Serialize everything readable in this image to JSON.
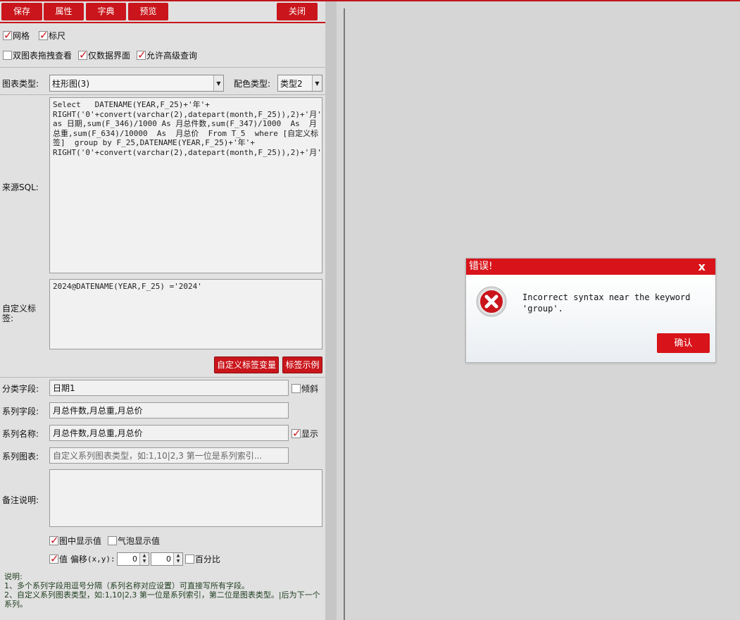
{
  "toolbar": {
    "save": "保存",
    "properties": "属性",
    "dictionary": "字典",
    "preview": "预览",
    "close": "关闭"
  },
  "options": {
    "grid": {
      "label": "网格",
      "checked": true
    },
    "ruler": {
      "label": "标尺",
      "checked": true
    },
    "dual_drag": {
      "label": "双图表拖拽查看",
      "checked": false
    },
    "data_only": {
      "label": "仅数据界面",
      "checked": true
    },
    "advanced_query": {
      "label": "允许高级查询",
      "checked": true
    }
  },
  "chart_type": {
    "label": "图表类型:",
    "value": "柱形图(3)"
  },
  "color_type": {
    "label": "配色类型:",
    "value": "类型2"
  },
  "source_sql": {
    "label": "来源SQL:",
    "value": "Select   DATENAME(YEAR,F_25)+'年'+   RIGHT('0'+convert(varchar(2),datepart(month,F_25)),2)+'月' as 日期,sum(F_346)/1000 As 月总件数,sum(F_347)/1000  As  月总重,sum(F_634)/10000  As  月总价  From T_5  where [自定义标签]  group by F_25,DATENAME(YEAR,F_25)+'年'+    RIGHT('0'+convert(varchar(2),datepart(month,F_25)),2)+'月'"
  },
  "custom_tag": {
    "label": "自定义标签:",
    "value": "2024@DATENAME(YEAR,F_25) ='2024'"
  },
  "tag_buttons": {
    "variable": "自定义标签变量",
    "example": "标签示例"
  },
  "category_field": {
    "label": "分类字段:",
    "value": "日期1",
    "tilt_label": "倾斜",
    "tilt_checked": false
  },
  "series_field": {
    "label": "系列字段:",
    "value": "月总件数,月总重,月总价"
  },
  "series_name": {
    "label": "系列名称:",
    "value": "月总件数,月总重,月总价",
    "show_label": "显示",
    "show_checked": true
  },
  "series_chart": {
    "label": "系列图表:",
    "placeholder": "自定义系列图表类型，如:1,10|2,3 第一位是系列索引..."
  },
  "remark": {
    "label": "备注说明:",
    "value": ""
  },
  "display": {
    "show_values": {
      "label": "图中显示值",
      "checked": true
    },
    "bubble_values": {
      "label": "气泡显示值",
      "checked": false
    },
    "value_offset": {
      "label": "值 偏移",
      "suffix": "(x,y):",
      "checked": true,
      "x": "0",
      "y": "0"
    },
    "percent": {
      "label": "百分比",
      "checked": false
    }
  },
  "notes": {
    "title": "说明:",
    "line1": "1、多个系列字段用逗号分隔（系列名称对应设置）可直接写所有字段。",
    "line2": "2、自定义系列图表类型，如:1,10|2,3 第一位是系列索引，第二位是图表类型。|后为下一个系列。"
  },
  "dialog": {
    "title": "错误!",
    "close_glyph": "x",
    "message_line1": "Incorrect syntax near the keyword",
    "message_line2": "'group'.",
    "confirm": "确认",
    "icon": "error-x-icon"
  },
  "colors": {
    "accent": "#c9151b",
    "dialog_header": "#d8141a"
  }
}
